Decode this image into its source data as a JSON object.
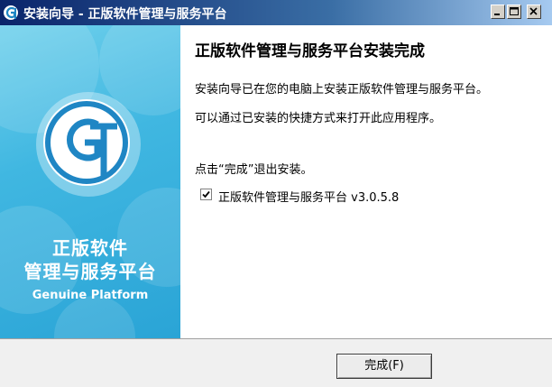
{
  "window": {
    "title": "安装向导 - 正版软件管理与服务平台",
    "colors": {
      "titlebar_start": "#0a246a",
      "titlebar_end": "#a6caf0",
      "banner": "#40b7e1",
      "logo_ring": "#1f86c4"
    },
    "controls": {
      "minimize_icon": "minimize-icon",
      "maximize_icon": "maximize-icon",
      "close_icon": "close-icon"
    }
  },
  "banner": {
    "line1": "正版软件",
    "line2": "管理与服务平台",
    "line3": "Genuine Platform",
    "logo_icon": "gp-logo-icon"
  },
  "content": {
    "heading": "正版软件管理与服务平台安装完成",
    "paragraph1": "安装向导已在您的电脑上安装正版软件管理与服务平台。",
    "paragraph2": "可以通过已安装的快捷方式来打开此应用程序。",
    "paragraph3": "点击“完成”退出安装。",
    "checkbox": {
      "label": "正版软件管理与服务平台 v3.0.5.8",
      "checked": true
    }
  },
  "footer": {
    "finish_label": "完成(F)"
  }
}
